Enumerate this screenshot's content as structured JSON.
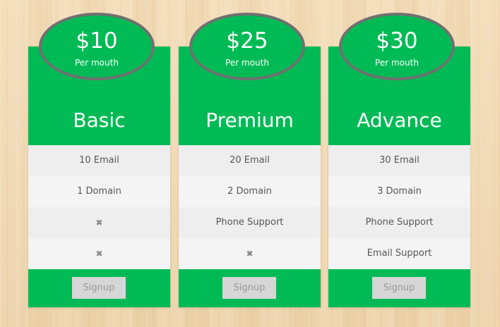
{
  "plans": [
    {
      "price": "$10",
      "period": "Per mouth",
      "name": "Basic",
      "features": [
        {
          "label": "10 Email",
          "icon": null
        },
        {
          "label": "1 Domain",
          "icon": null
        },
        {
          "label": "",
          "icon": "close-icon",
          "glyph": "✖"
        },
        {
          "label": "",
          "icon": "close-icon",
          "glyph": "✖"
        }
      ],
      "button_label": "Signup"
    },
    {
      "price": "$25",
      "period": "Per mouth",
      "name": "Premium",
      "features": [
        {
          "label": "20 Email",
          "icon": null
        },
        {
          "label": "2 Domain",
          "icon": null
        },
        {
          "label": "Phone Support",
          "icon": null
        },
        {
          "label": "",
          "icon": "close-icon",
          "glyph": "✖"
        }
      ],
      "button_label": "Signup"
    },
    {
      "price": "$30",
      "period": "Per mouth",
      "name": "Advance",
      "features": [
        {
          "label": "30 Email",
          "icon": null
        },
        {
          "label": "3 Domain",
          "icon": null
        },
        {
          "label": "Phone Support",
          "icon": null
        },
        {
          "label": "Email Support",
          "icon": null
        }
      ],
      "button_label": "Signup"
    }
  ],
  "colors": {
    "accent_green": "#00bb55",
    "oval_border": "#707070",
    "feature_bg": "#eeeeee",
    "feature_alt_bg": "#f4f4f4",
    "button_bg": "#d6d6d6",
    "button_text": "#999999",
    "background_wood": "#f0d9b5"
  }
}
